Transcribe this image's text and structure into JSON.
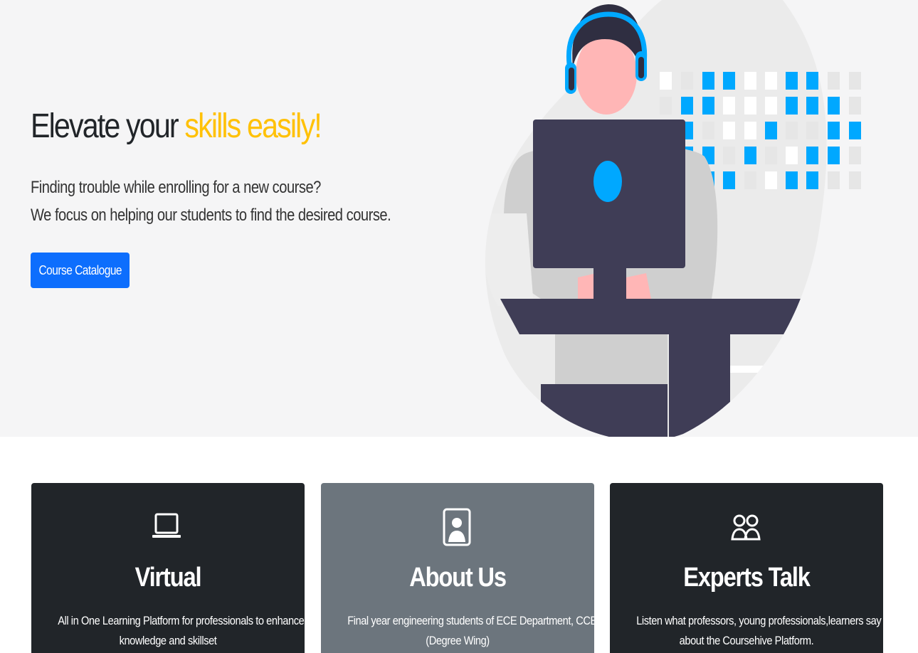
{
  "hero": {
    "title_prefix": "Elevate your ",
    "title_accent": "skills easily!",
    "line1": "Finding trouble while enrolling for a new course?",
    "line2": "We focus on helping our students to find the desired course.",
    "cta_label": "Course Catalogue",
    "colors": {
      "accent": "#ffc107",
      "button": "#0d6efd",
      "illustration_blue": "#00a8ff",
      "illustration_dark": "#3f3d56"
    }
  },
  "cards": [
    {
      "icon": "laptop-icon",
      "title": "Virtual",
      "desc_line1": "All in One Learning Platform for professionals to enhance the",
      "desc_line2": "knowledge and skillset",
      "background": "#212529"
    },
    {
      "icon": "person-badge-icon",
      "title": "About Us",
      "desc_line1": "Final year engineering students of ECE Department, CCET",
      "desc_line2": "(Degree Wing)",
      "background": "#6c757d"
    },
    {
      "icon": "people-icon",
      "title": "Experts Talk",
      "desc_line1": "Listen what professors, young professionals,learners say",
      "desc_line2": "about the Coursehive Platform.",
      "background": "#212529"
    }
  ]
}
